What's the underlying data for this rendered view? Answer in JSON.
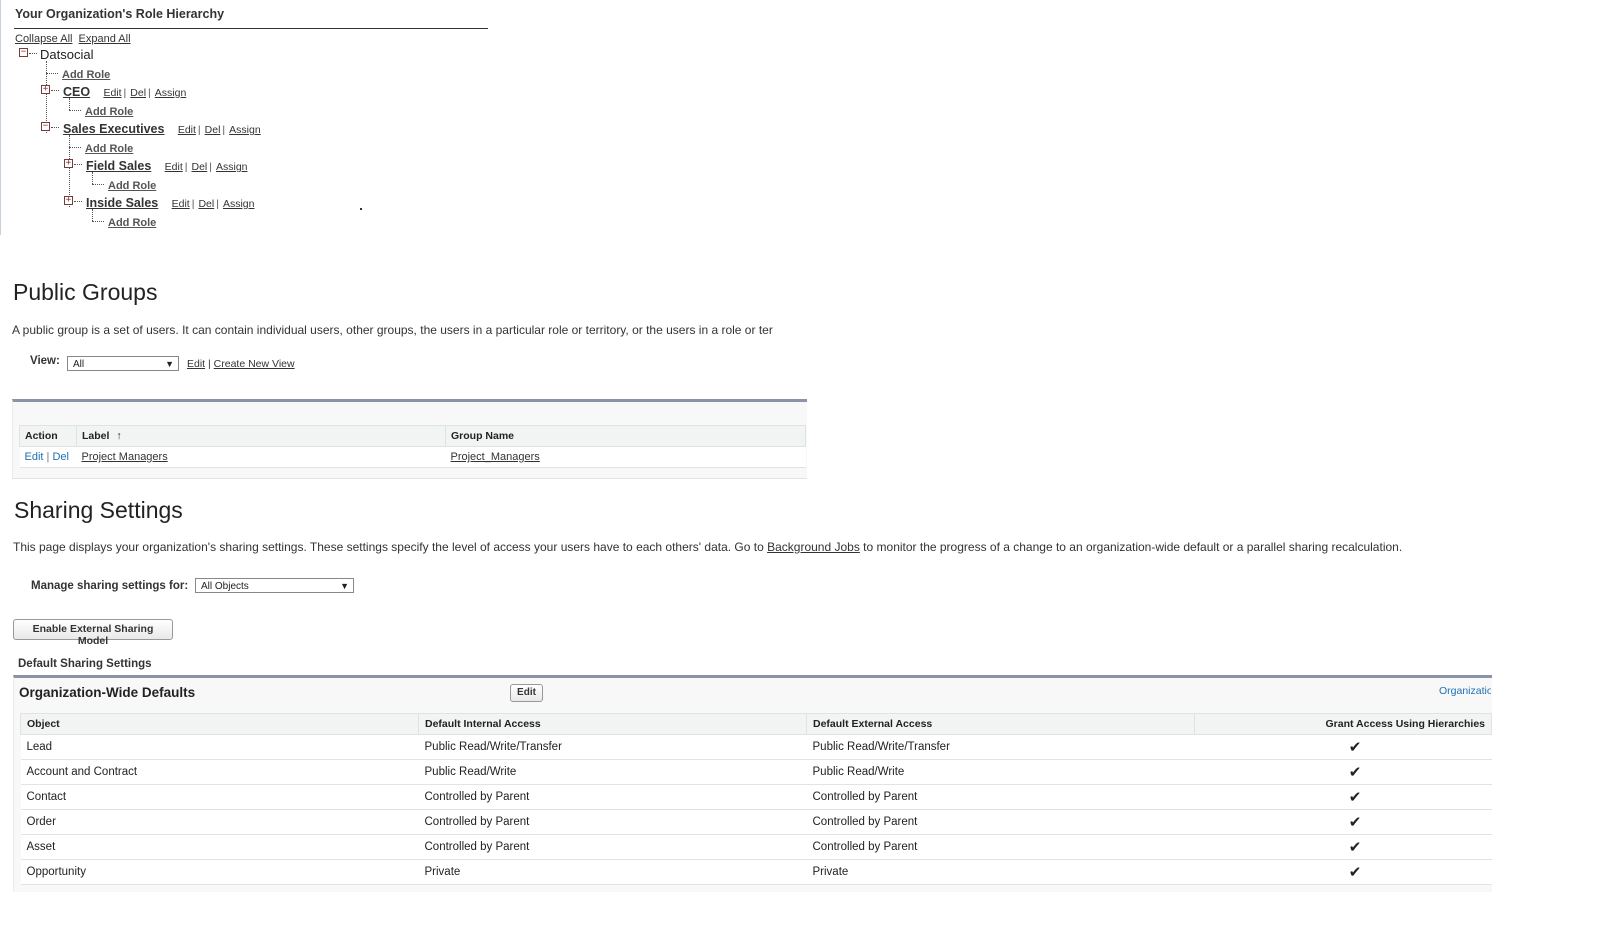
{
  "role_hierarchy": {
    "title": "Your Organization's Role Hierarchy",
    "collapse_all": "Collapse All",
    "expand_all": "Expand All",
    "root": "Datsocial",
    "add_role": "Add Role",
    "edit": "Edit",
    "del": "Del",
    "assign": "Assign",
    "sep": "|",
    "roles": [
      "CEO",
      "Sales Executives",
      "Field Sales",
      "Inside Sales"
    ],
    "icons": {
      "expanded": "minus-toggle-icon",
      "collapsed": "plus-toggle-icon"
    }
  },
  "public_groups": {
    "heading": "Public Groups",
    "description": "A public group is a set of users. It can contain individual users, other groups, the users in a particular role or territory, or the users in a role or ter",
    "view_label": "View:",
    "view_value": "All",
    "edit_link": "Edit",
    "link_sep": "|",
    "create_view_link": "Create New View",
    "columns": {
      "action": "Action",
      "label": "Label",
      "sort_arrow": "↑",
      "group_name": "Group Name"
    },
    "rows": [
      {
        "edit": "Edit",
        "sep": "|",
        "del": "Del",
        "label": "Project Managers",
        "group_name": "Project_Managers"
      }
    ]
  },
  "sharing": {
    "heading": "Sharing Settings",
    "desc_before": "This page displays your organization's sharing settings. These settings specify the level of access your users have to each others' data. Go to ",
    "desc_link": "Background Jobs",
    "desc_after": " to monitor the progress of a change to an organization-wide default or a parallel sharing recalculation.",
    "manage_label": "Manage sharing settings for:",
    "manage_value": "All Objects",
    "enable_button": "Enable External Sharing Model",
    "default_title": "Default Sharing Settings",
    "owd_title": "Organization-Wide Defaults",
    "owd_edit": "Edit",
    "owd_help": "Organization-Wide Defaults Help",
    "columns": {
      "object": "Object",
      "internal": "Default Internal Access",
      "external": "Default External Access",
      "hierarchies": "Grant Access Using Hierarchies"
    },
    "check_icon": "checkmark-icon",
    "check_glyph": "✔",
    "rows": [
      {
        "object": "Lead",
        "internal": "Public Read/Write/Transfer",
        "external": "Public Read/Write/Transfer",
        "granted": true
      },
      {
        "object": "Account and Contract",
        "internal": "Public Read/Write",
        "external": "Public Read/Write",
        "granted": true
      },
      {
        "object": "Contact",
        "internal": "Controlled by Parent",
        "external": "Controlled by Parent",
        "granted": true
      },
      {
        "object": "Order",
        "internal": "Controlled by Parent",
        "external": "Controlled by Parent",
        "granted": true
      },
      {
        "object": "Asset",
        "internal": "Controlled by Parent",
        "external": "Controlled by Parent",
        "granted": true
      },
      {
        "object": "Opportunity",
        "internal": "Private",
        "external": "Private",
        "granted": true
      }
    ]
  }
}
